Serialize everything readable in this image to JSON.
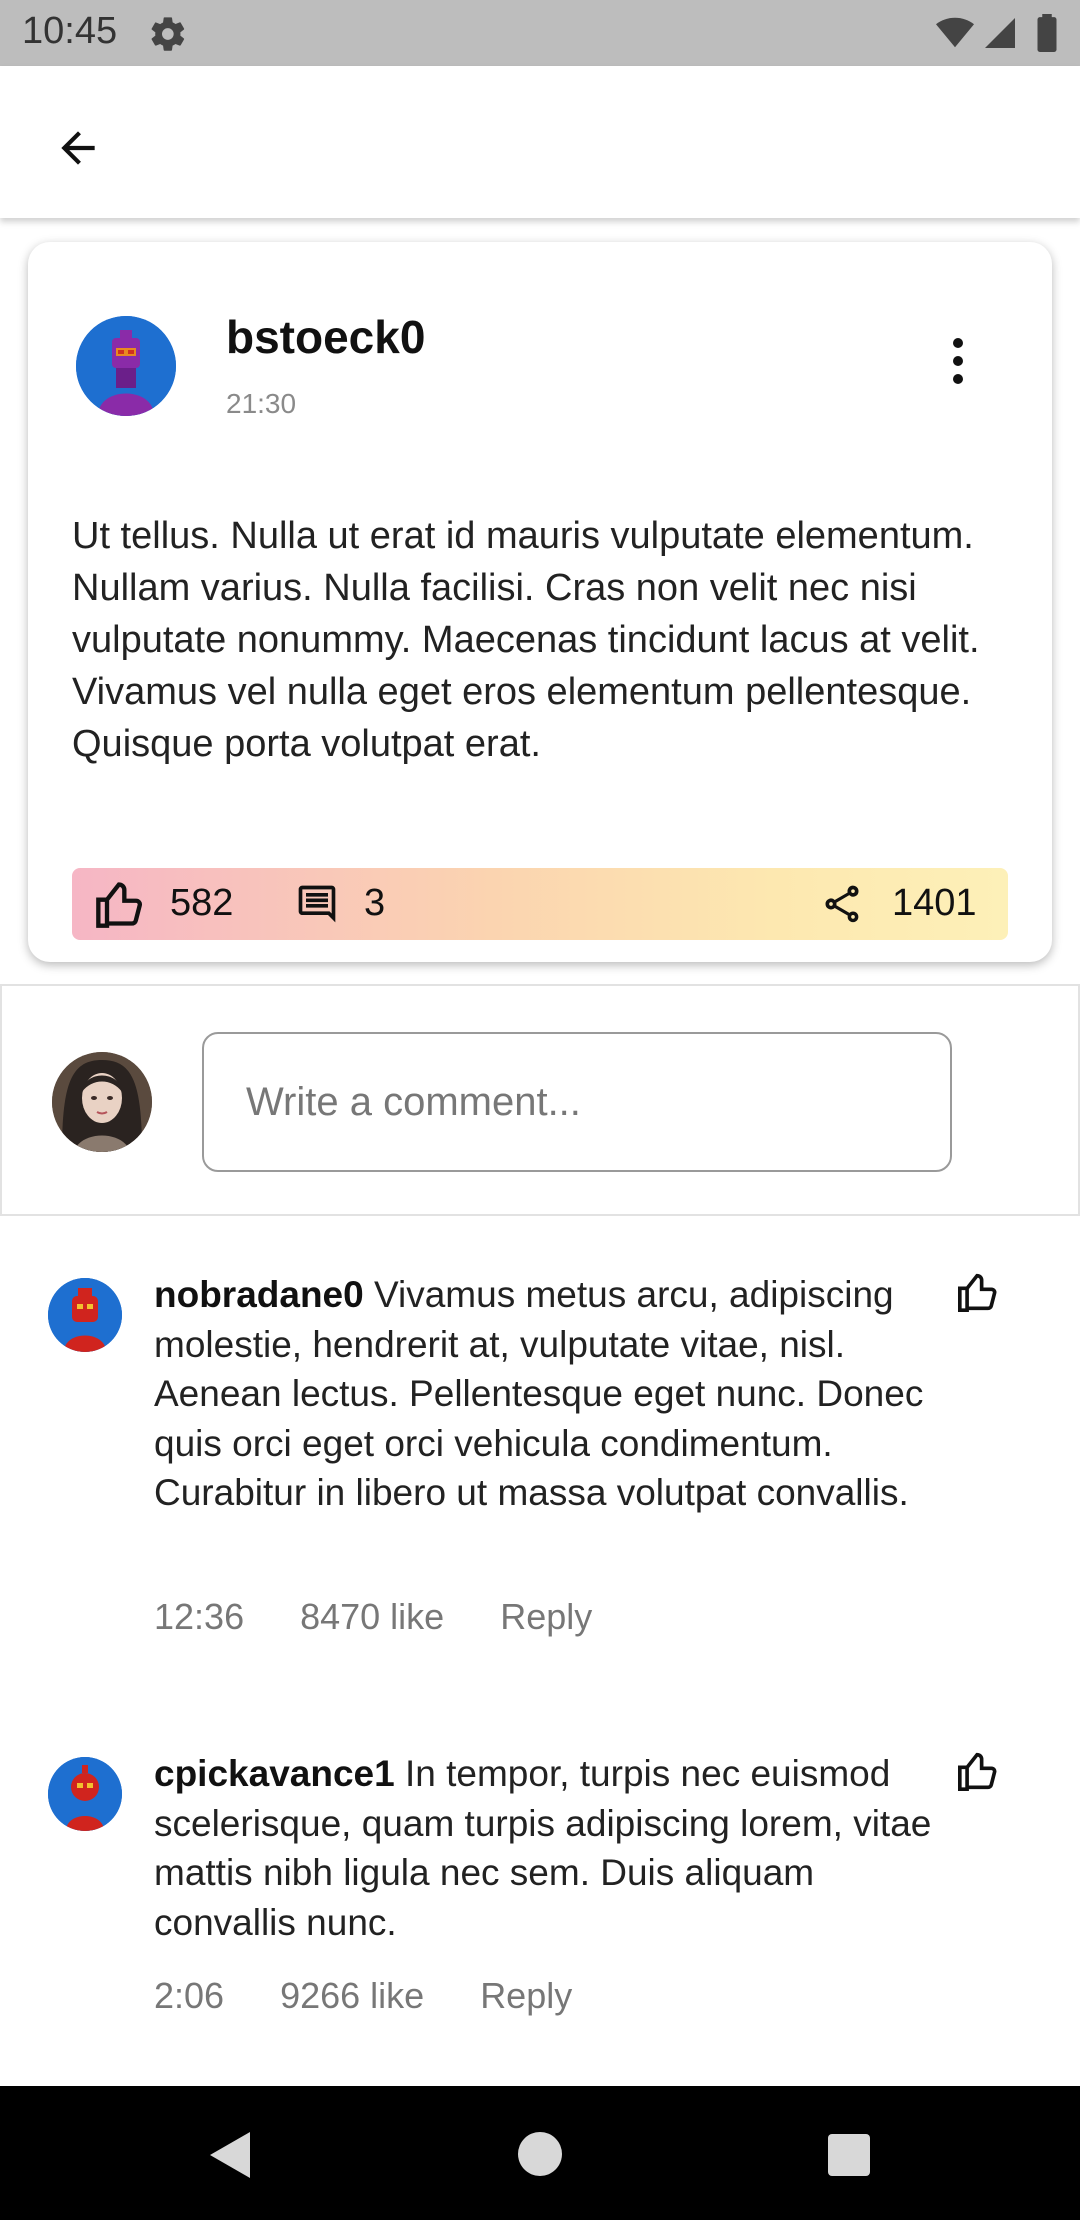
{
  "status_bar": {
    "time": "10:45",
    "icons": [
      "gear-icon",
      "wifi-icon",
      "signal-icon",
      "battery-icon"
    ]
  },
  "app_bar": {
    "back_icon": "arrow-left-icon"
  },
  "post": {
    "author": "bstoeck0",
    "time": "21:30",
    "body": "Ut tellus. Nulla ut erat id mauris vulputate elementum. Nullam varius. Nulla facilisi. Cras non velit nec nisi vulputate nonummy. Maecenas tincidunt lacus at velit. Vivamus vel nulla eget eros elementum pellentesque. Quisque porta volutpat erat.",
    "likes": "582",
    "comments": "3",
    "shares": "1401",
    "gradient_colors": [
      "#f6b6c5",
      "#fbd4b0",
      "#fdf0b8"
    ]
  },
  "comment_input": {
    "placeholder": "Write a comment..."
  },
  "comments": [
    {
      "user": "nobradane0",
      "text": "Vivamus metus arcu, adipiscing molestie, hendrerit at, vulputate vitae, nisl. Aenean lectus. Pellentesque eget nunc. Donec quis orci eget orci vehicula condimentum. Curabitur in libero ut massa volutpat convallis.",
      "time": "12:36",
      "likes": "8470 like",
      "reply": "Reply"
    },
    {
      "user": "cpickavance1",
      "text": "In tempor, turpis nec euismod scelerisque, quam turpis adipiscing lorem, vitae mattis nibh ligula nec sem. Duis aliquam convallis nunc.",
      "time": "2:06",
      "likes": "9266 like",
      "reply": "Reply"
    }
  ],
  "nav_bar": {
    "icons": [
      "nav-back-icon",
      "nav-home-icon",
      "nav-recents-icon"
    ]
  }
}
